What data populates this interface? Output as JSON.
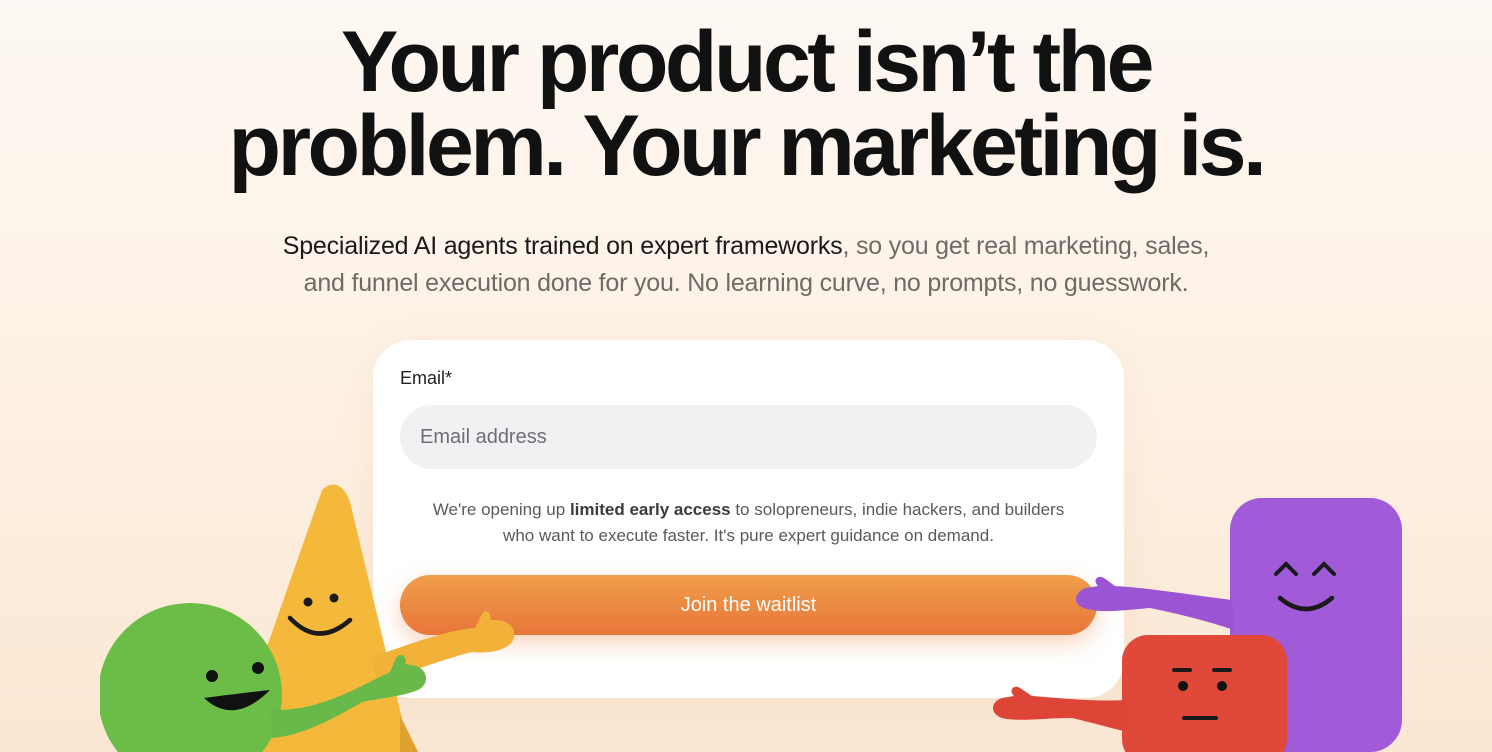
{
  "hero": {
    "title_line1": "Your product isn’t the",
    "title_line2": "problem. Your marketing is."
  },
  "subtitle": {
    "strong": "Specialized AI agents trained on expert frameworks",
    "rest_line1": ", so you get real marketing, sales,",
    "line2": "and funnel execution done for you. No learning curve, no prompts, no guesswork."
  },
  "form": {
    "email_label": "Email*",
    "email_placeholder": "Email address",
    "note_prefix": "We're opening up ",
    "note_bold": "limited early access",
    "note_suffix": " to solopreneurs, indie hackers, and builders",
    "note_line2": "who want to execute faster. It's pure expert guidance on demand.",
    "submit_label": "Join the waitlist"
  },
  "colors": {
    "accent": "#e8763a",
    "background": "#fdf0e2",
    "mascot_yellow": "#f4b83a",
    "mascot_green": "#6cbc48",
    "mascot_purple": "#a15ad8",
    "mascot_red": "#e0483a"
  }
}
